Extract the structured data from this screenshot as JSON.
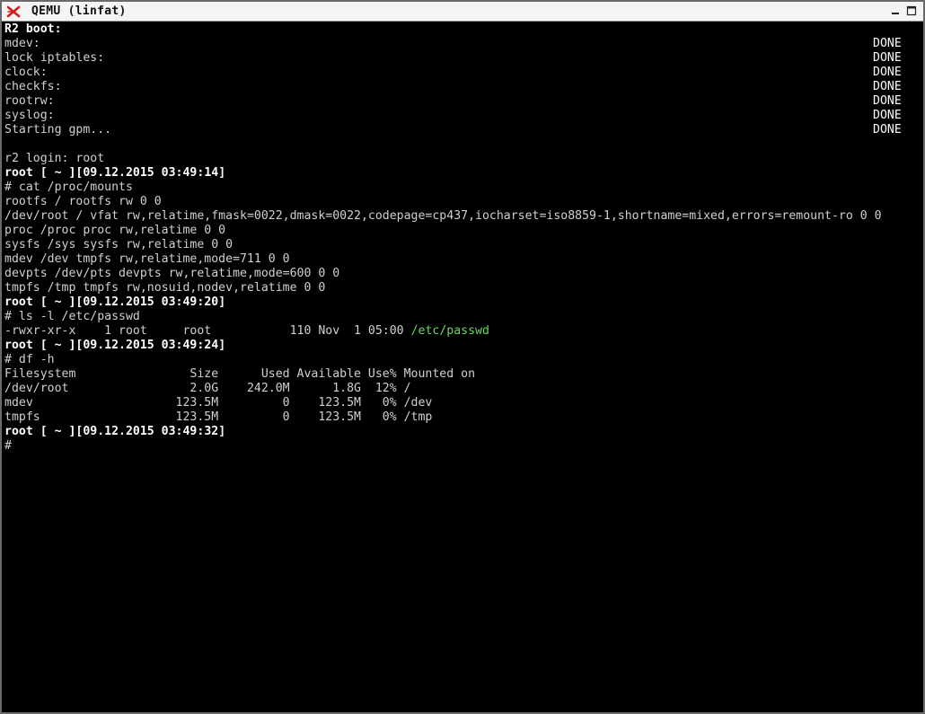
{
  "window": {
    "title": "QEMU (linfat)",
    "icon": "qemu-logo-icon",
    "buttons": [
      "minimize-icon",
      "maximize-icon"
    ]
  },
  "colors": {
    "background": "#000000",
    "text": "#d0d0d0",
    "bright": "#ffffff",
    "link": "#66d95c",
    "icon_red": "#d11f1f"
  },
  "console": {
    "boot": {
      "header": "R2 boot:",
      "steps": [
        {
          "label": "mdev:",
          "status": "DONE"
        },
        {
          "label": "lock iptables:",
          "status": "DONE"
        },
        {
          "label": "clock:",
          "status": "DONE"
        },
        {
          "label": "checkfs:",
          "status": "DONE"
        },
        {
          "label": "rootrw:",
          "status": "DONE"
        },
        {
          "label": "syslog:",
          "status": "DONE"
        },
        {
          "label": "Starting gpm...",
          "status": "DONE"
        }
      ]
    },
    "login": "r2 login: root",
    "prompts": [
      {
        "user": "root",
        "rest": " [ ~ ][09.12.2015 03:49:14]"
      },
      {
        "user": "root",
        "rest": " [ ~ ][09.12.2015 03:49:20]"
      },
      {
        "user": "root",
        "rest": " [ ~ ][09.12.2015 03:49:24]"
      },
      {
        "user": "root",
        "rest": " [ ~ ][09.12.2015 03:49:32]"
      }
    ],
    "commands": [
      "# cat /proc/mounts",
      "# ls -l /etc/passwd",
      "# df -h"
    ],
    "mounts": [
      "rootfs / rootfs rw 0 0",
      "/dev/root / vfat rw,relatime,fmask=0022,dmask=0022,codepage=cp437,iocharset=iso8859-1,shortname=mixed,errors=remount-ro 0 0",
      "proc /proc proc rw,relatime 0 0",
      "sysfs /sys sysfs rw,relatime 0 0",
      "mdev /dev tmpfs rw,relatime,mode=711 0 0",
      "devpts /dev/pts devpts rw,relatime,mode=600 0 0",
      "tmpfs /tmp tmpfs rw,nosuid,nodev,relatime 0 0"
    ],
    "ls_line": {
      "prefix": "-rwxr-xr-x    1 root     root           110 Nov  1 05:00 ",
      "file": "/etc/passwd"
    },
    "df": {
      "header": "Filesystem                Size      Used Available Use% Mounted on",
      "rows": [
        "/dev/root                 2.0G    242.0M      1.8G  12% /",
        "mdev                    123.5M         0    123.5M   0% /dev",
        "tmpfs                   123.5M         0    123.5M   0% /tmp"
      ]
    },
    "final_prompt": "#"
  }
}
